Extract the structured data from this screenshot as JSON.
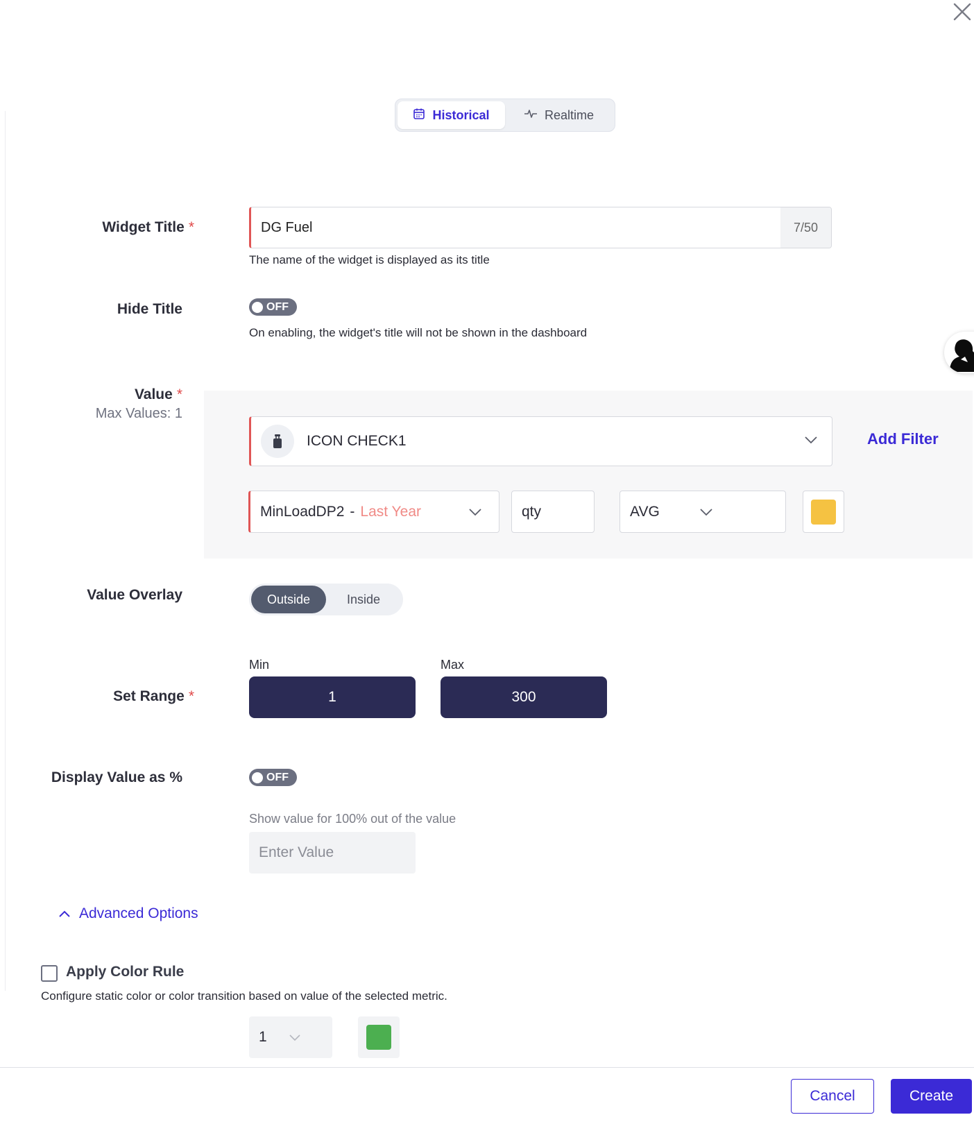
{
  "mode_tabs": [
    {
      "label": "Historical",
      "active": true,
      "icon": "calendar-icon"
    },
    {
      "label": "Realtime",
      "active": false,
      "icon": "pulse-icon"
    }
  ],
  "widget_title": {
    "label": "Widget Title",
    "required_mark": "*",
    "value": "DG Fuel",
    "count": "7/50",
    "help": "The name of the widget is displayed as its title"
  },
  "hide_title": {
    "label": "Hide Title",
    "toggle_text": "OFF",
    "help": "On enabling, the widget's title will not be shown in the dashboard"
  },
  "value": {
    "label": "Value",
    "required_mark": "*",
    "max_values": "Max Values: 1",
    "device": "ICON CHECK1",
    "add_filter": "Add Filter",
    "datapoint": "MinLoadDP2",
    "separator": "-",
    "period": "Last Year",
    "unit": "qty",
    "aggregation": "AVG",
    "series_color": "#f5c242"
  },
  "value_overlay": {
    "label": "Value Overlay",
    "options": [
      "Outside",
      "Inside"
    ],
    "selected": "Outside"
  },
  "set_range": {
    "label": "Set Range",
    "required_mark": "*",
    "min_label": "Min",
    "max_label": "Max",
    "min": "1",
    "max": "300"
  },
  "display_percent": {
    "label": "Display Value as %",
    "toggle_text": "OFF",
    "help": "Show value for 100% out of the value",
    "placeholder": "Enter Value"
  },
  "advanced": {
    "label": "Advanced Options",
    "color_rule_label": "Apply Color Rule",
    "color_rule_help": "Configure static color or color transition based on value of the selected metric.",
    "rule_value": "1",
    "rule_color": "#4caf50"
  },
  "footer": {
    "cancel": "Cancel",
    "create": "Create"
  },
  "colors": {
    "accent": "#3b2ad6",
    "required": "#e04a4a",
    "range_bg": "#2b2b55"
  }
}
